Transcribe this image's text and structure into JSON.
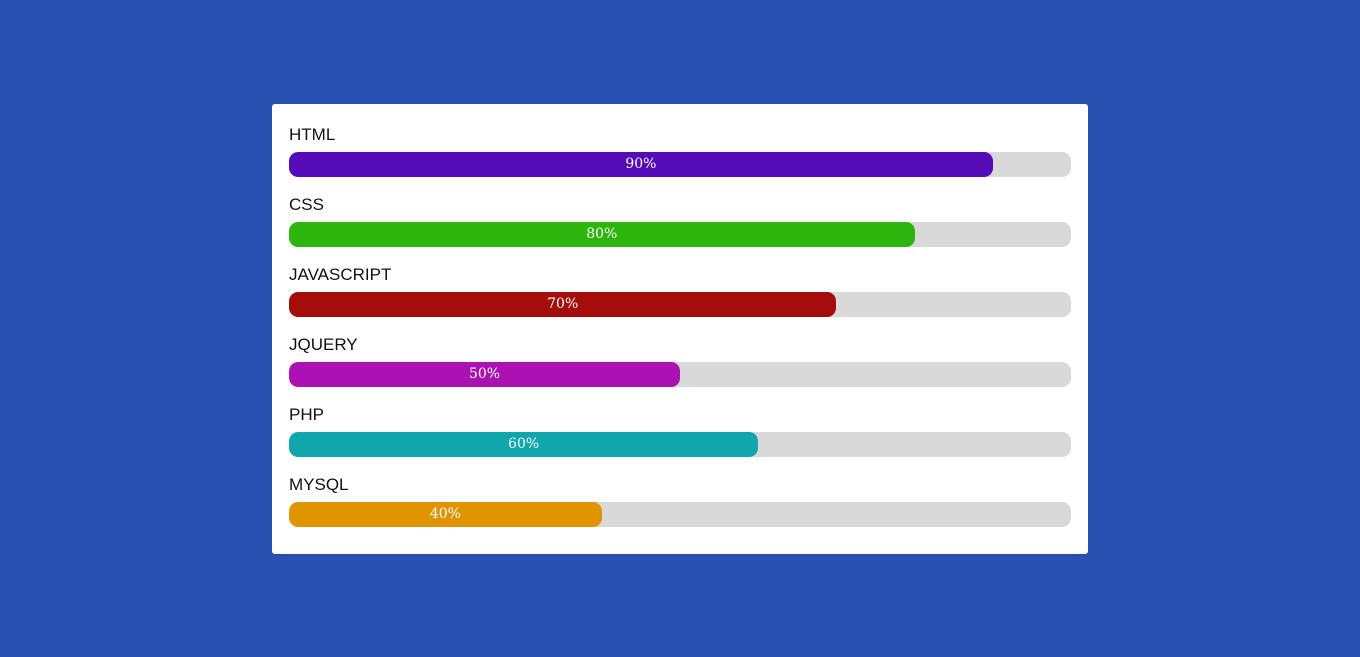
{
  "skills": [
    {
      "label": "HTML",
      "percent_text": "90%",
      "value": 0.9,
      "color": "#560bb8"
    },
    {
      "label": "CSS",
      "percent_text": "80%",
      "value": 0.8,
      "color": "#2cb50c"
    },
    {
      "label": "JAVASCRIPT",
      "percent_text": "70%",
      "value": 0.7,
      "color": "#a50c0c"
    },
    {
      "label": "JQUERY",
      "percent_text": "50%",
      "value": 0.5,
      "color": "#aa12b3"
    },
    {
      "label": "PHP",
      "percent_text": "60%",
      "value": 0.6,
      "color": "#0fa6ad"
    },
    {
      "label": "MYSQL",
      "percent_text": "40%",
      "value": 0.4,
      "color": "#e09500"
    }
  ]
}
